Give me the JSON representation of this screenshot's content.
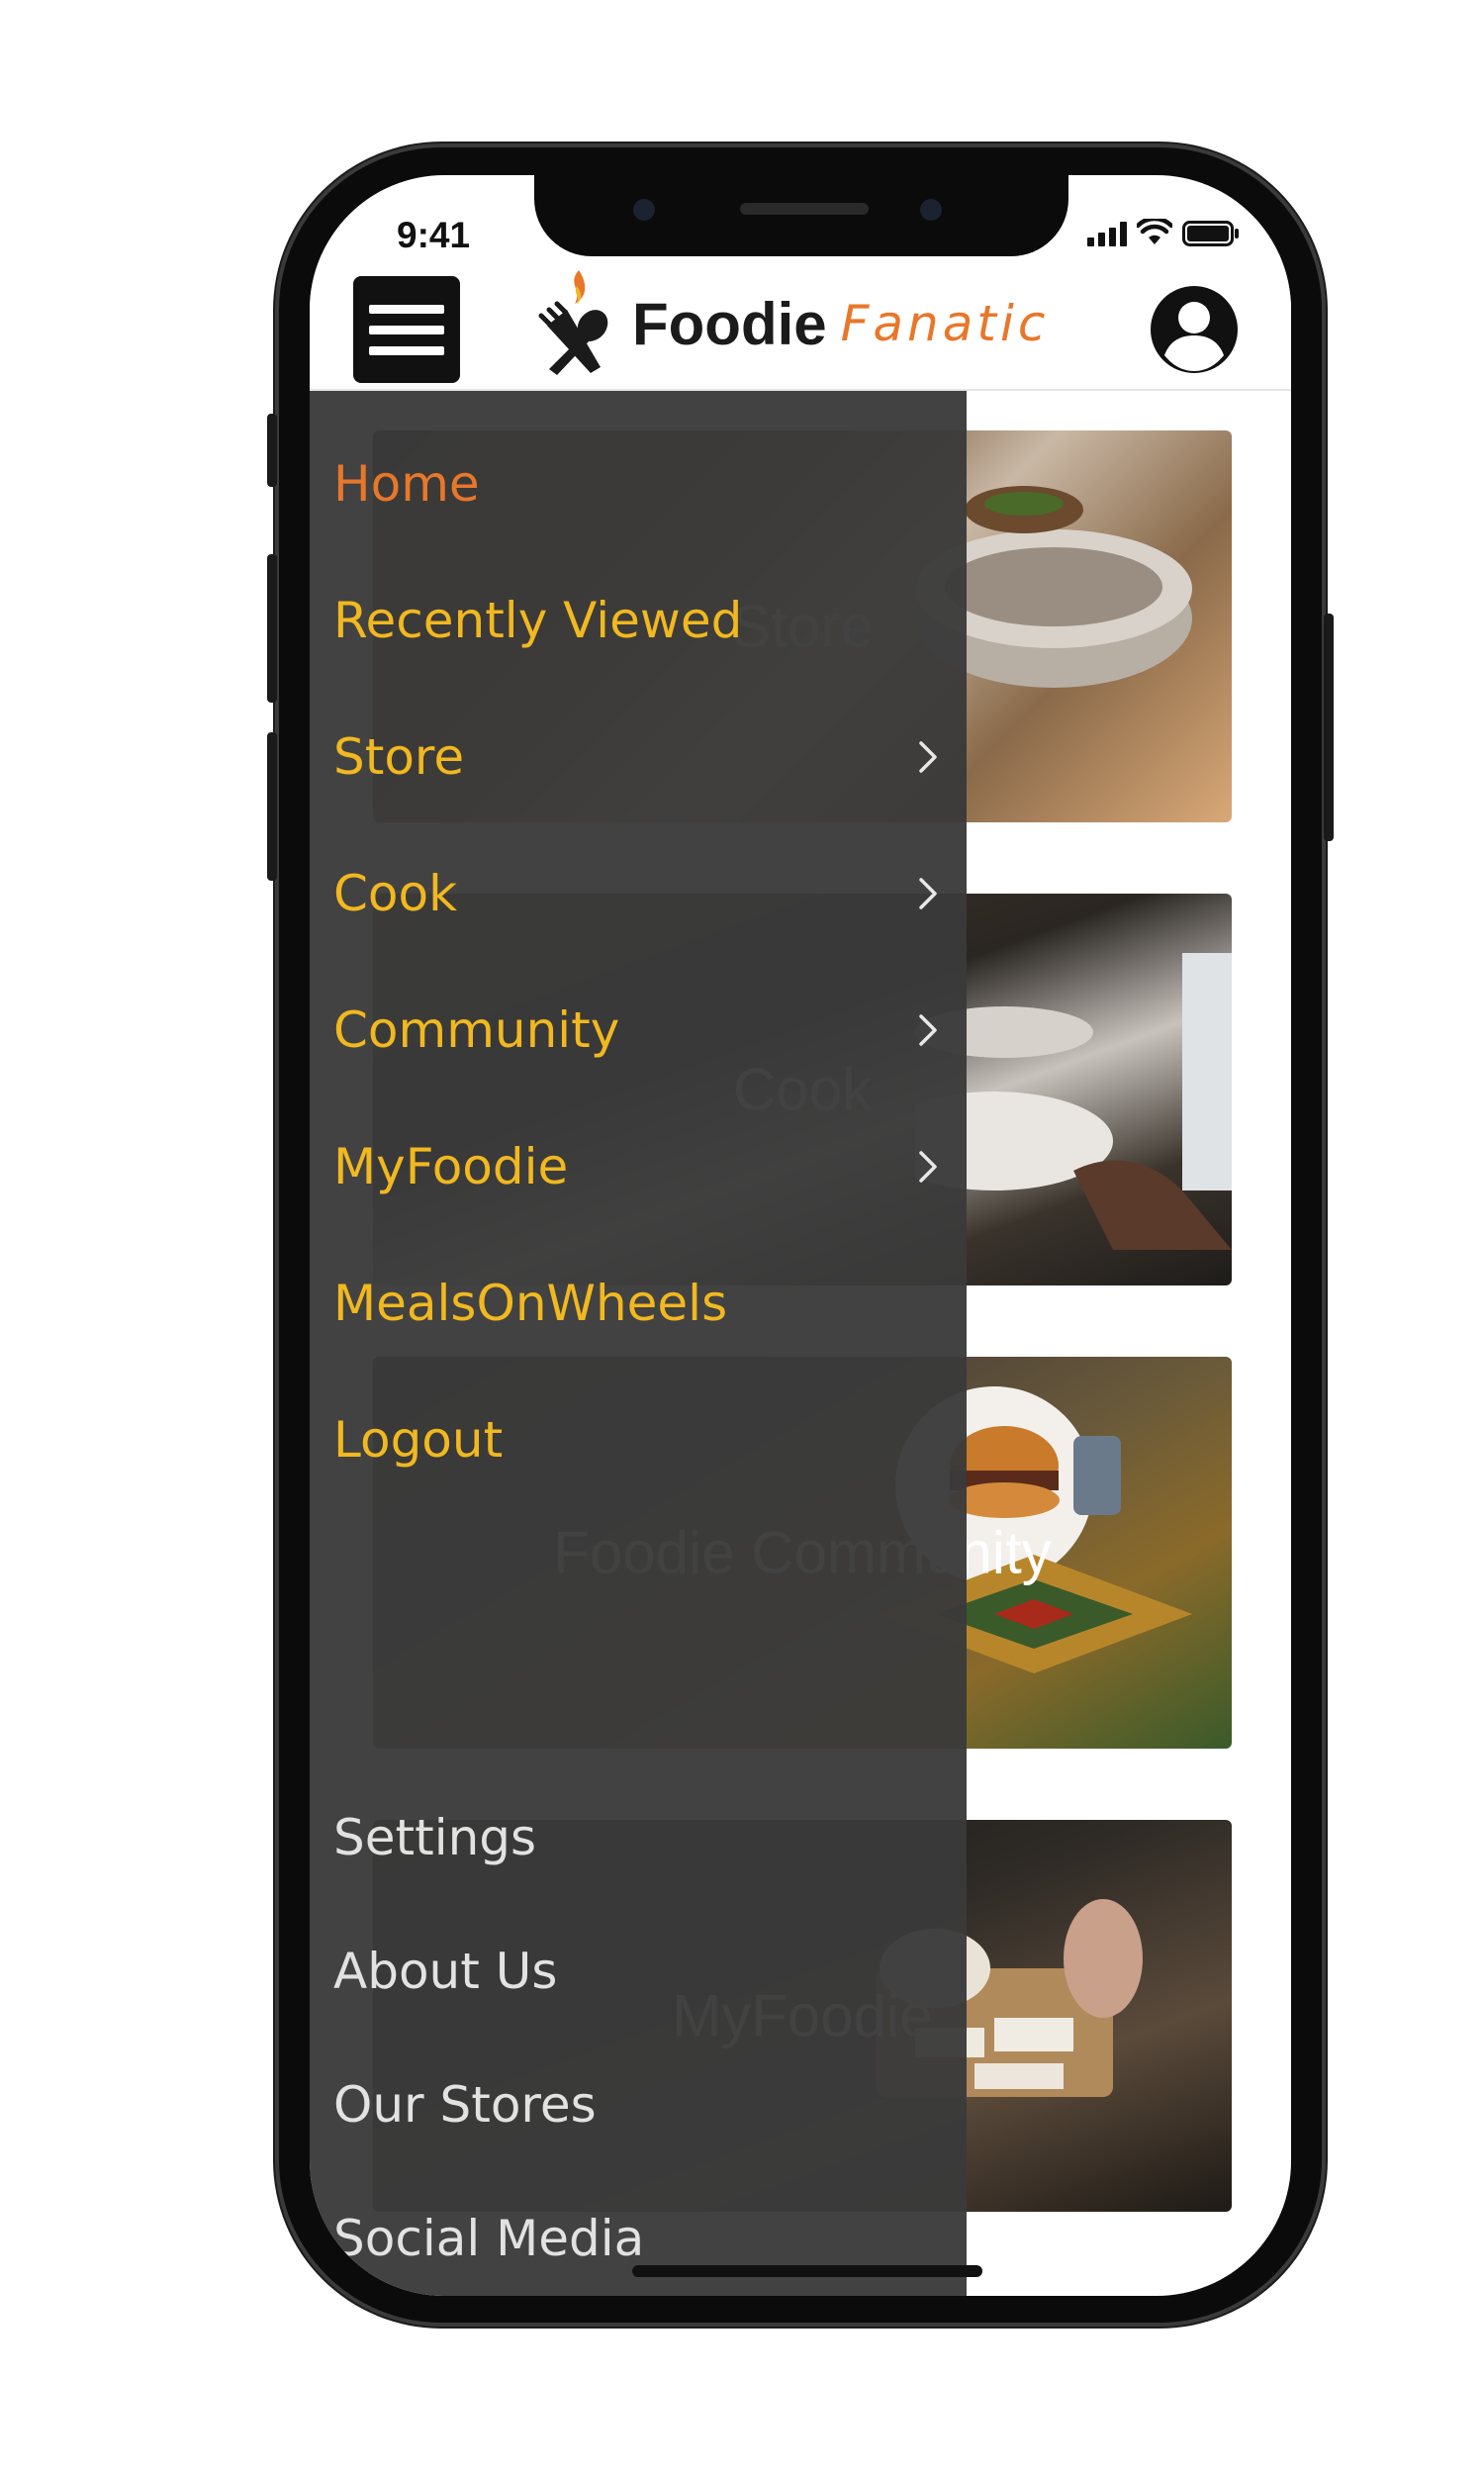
{
  "status_bar": {
    "time": "9:41"
  },
  "header": {
    "brand_word1": "Foodie",
    "brand_word2": "Fanatic",
    "accent_color": "#e8772a"
  },
  "content_cards": [
    {
      "title": "Store",
      "theme": "cookware"
    },
    {
      "title": "Cook",
      "theme": "plated-dinner"
    },
    {
      "title": "Foodie Community",
      "theme": "burger-table"
    },
    {
      "title": "MyFoodie",
      "theme": "cheese-board"
    }
  ],
  "drawer": {
    "primary_items": [
      {
        "label": "Home",
        "active": true,
        "has_submenu": false
      },
      {
        "label": "Recently Viewed",
        "active": false,
        "has_submenu": false
      },
      {
        "label": "Store",
        "active": false,
        "has_submenu": true
      },
      {
        "label": "Cook",
        "active": false,
        "has_submenu": true
      },
      {
        "label": "Community",
        "active": false,
        "has_submenu": true
      },
      {
        "label": "MyFoodie",
        "active": false,
        "has_submenu": true
      },
      {
        "label": "MealsOnWheels",
        "active": false,
        "has_submenu": false
      },
      {
        "label": "Logout",
        "active": false,
        "has_submenu": false
      }
    ],
    "secondary_items": [
      {
        "label": "Settings"
      },
      {
        "label": "About Us"
      },
      {
        "label": "Our Stores"
      },
      {
        "label": "Social Media"
      }
    ],
    "colors": {
      "primary": "#f1b81f",
      "active": "#e8772a",
      "secondary": "#e2e2e2"
    }
  }
}
